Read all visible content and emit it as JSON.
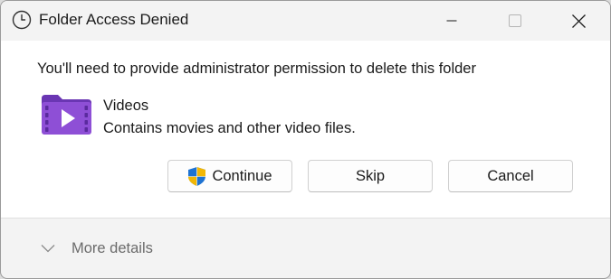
{
  "window": {
    "title": "Folder Access Denied",
    "controls": {
      "minimize_icon": "minimize-icon",
      "maximize_icon": "maximize-icon",
      "close_icon": "close-icon"
    }
  },
  "dialog": {
    "message": "You'll need to provide administrator permission to delete this folder",
    "item": {
      "icon": "videos-folder-icon",
      "name": "Videos",
      "description": "Contains movies and other video files."
    },
    "buttons": {
      "continue_label": "Continue",
      "skip_label": "Skip",
      "cancel_label": "Cancel"
    },
    "details_label": "More details"
  },
  "colors": {
    "folder_purple": "#8e4fd6",
    "folder_dark": "#6a36b3",
    "shield_blue": "#1e73d2",
    "shield_yellow": "#f2b705"
  }
}
